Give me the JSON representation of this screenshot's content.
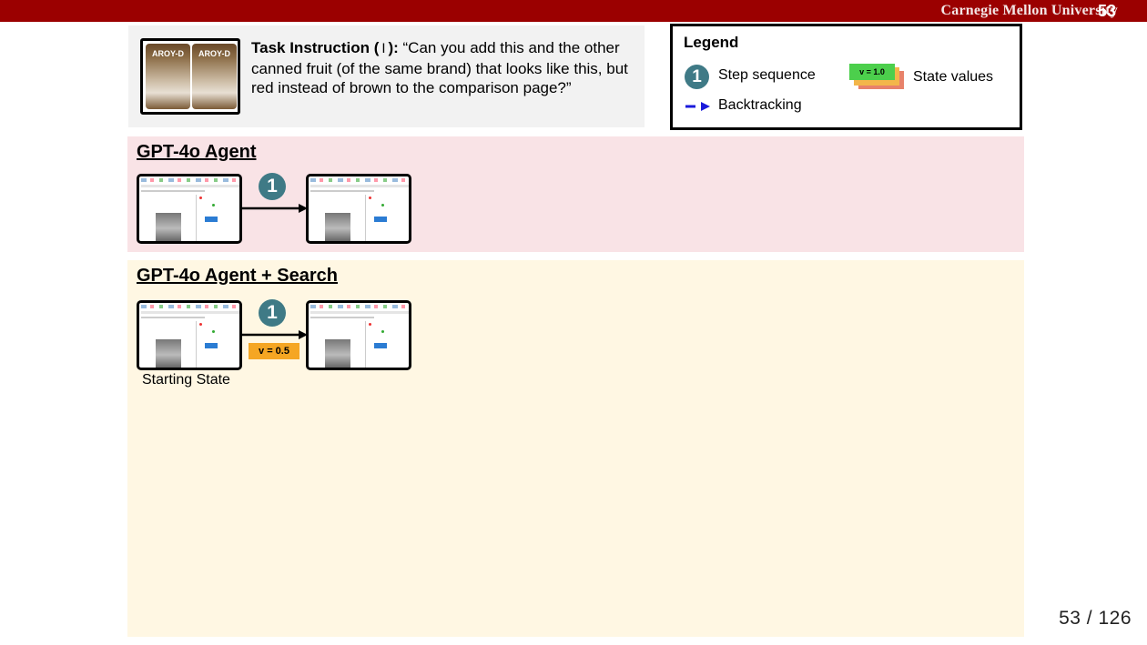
{
  "header": {
    "university": "Carnegie Mellon University",
    "slide_number": "53"
  },
  "task": {
    "image_brand_label": "AROY-D",
    "label": "Task Instruction (",
    "label_close": "):",
    "cursor_glyph": "I",
    "text": "“Can you add this and the other canned fruit (of the same brand) that looks like this, but red instead of brown to the comparison page?”"
  },
  "legend": {
    "title": "Legend",
    "step_badge": "1",
    "step_label": "Step sequence",
    "state_value_sample": "v = 1.0",
    "state_label": "State values",
    "backtrack_label": "Backtracking"
  },
  "sections": {
    "agent": {
      "title": "GPT-4o Agent",
      "step": "1"
    },
    "agent_search": {
      "title": "GPT-4o Agent + Search",
      "step": "1",
      "value": "v = 0.5",
      "start_label": "Starting State"
    }
  },
  "colors": {
    "header_bar": "#9b0000",
    "step_badge": "#3f7a86",
    "pink_section": "#f9e3e6",
    "yellow_section": "#fff7e3",
    "value_badge": "#f5a623",
    "backtrack_arrow": "#1a1adb"
  },
  "footer": {
    "page_counter": "53 / 126"
  }
}
